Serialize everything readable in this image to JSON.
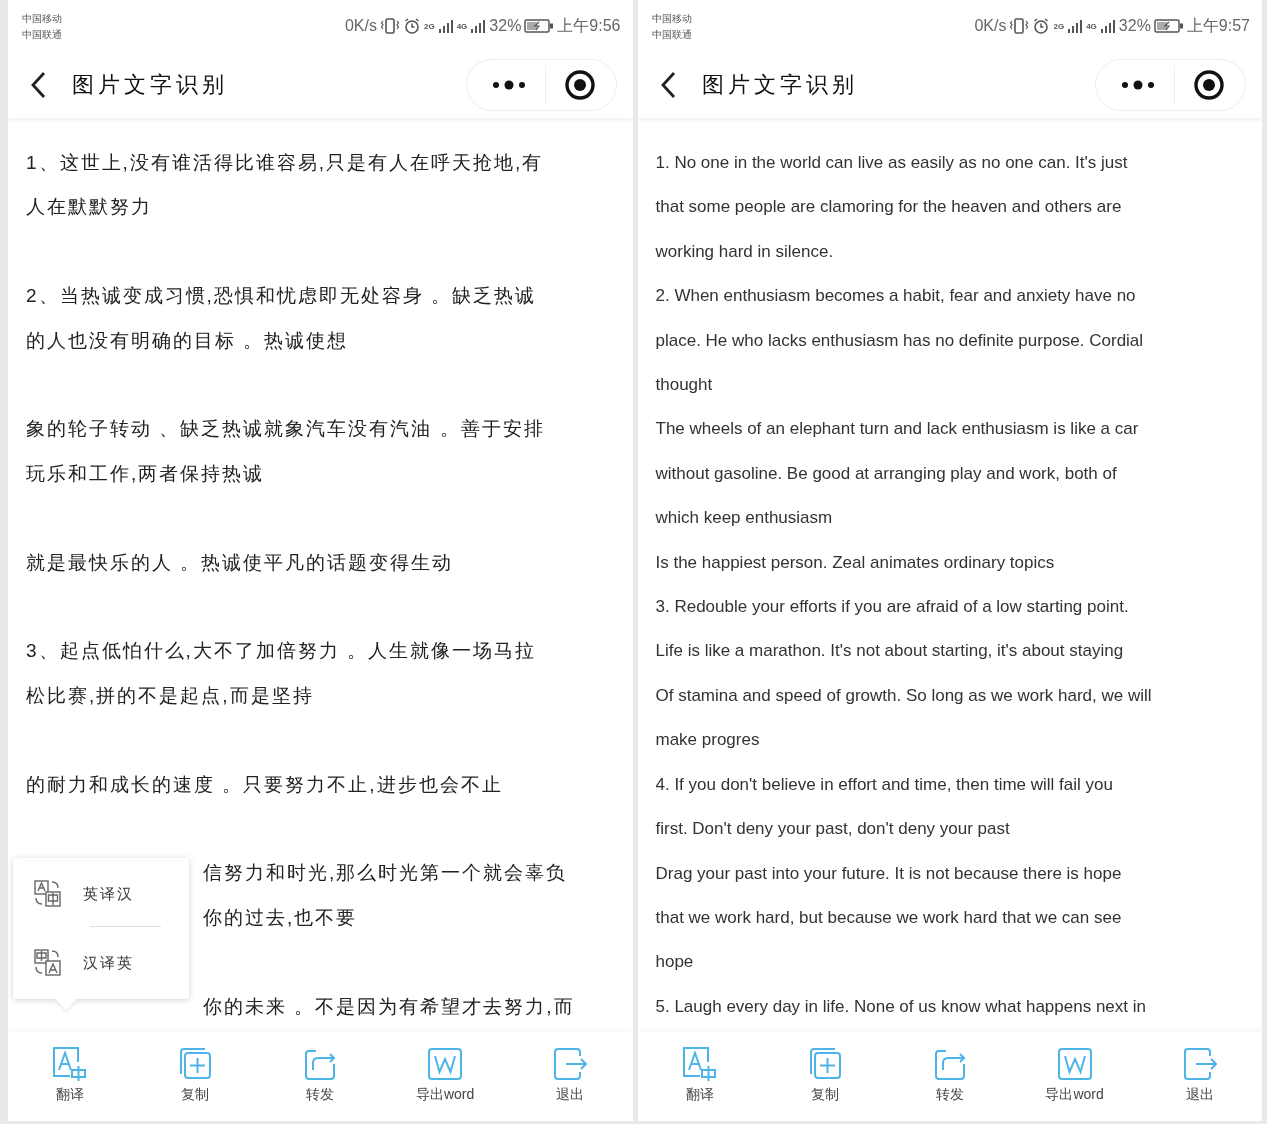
{
  "screens": [
    {
      "status_bar": {
        "carriers": [
          "中国移动",
          "中国联通"
        ],
        "speed": "0K/s",
        "networks": [
          "2G",
          "4G"
        ],
        "battery": "32%",
        "time": "上午9:56"
      },
      "title": "图片文字识别",
      "content": {
        "kind": "paragraphs",
        "paragraphs": [
          {
            "lines": [
              "1、这世上,没有谁活得比谁容易,只是有人在呼天抢地,有",
              "人在默默努力"
            ]
          },
          {
            "lines": [
              "2、当热诚变成习惯,恐惧和忧虑即无处容身 。缺乏热诚",
              "的人也没有明确的目标 。热诚使想"
            ]
          },
          {
            "lines": [
              "象的轮子转动 、缺乏热诚就象汽车没有汽油 。善于安排",
              "玩乐和工作,两者保持热诚"
            ]
          },
          {
            "lines": [
              "就是最快乐的人 。热诚使平凡的话题变得生动"
            ]
          },
          {
            "lines": [
              "3、起点低怕什么,大不了加倍努力 。人生就像一场马拉",
              "松比赛,拼的不是起点,而是坚持"
            ]
          },
          {
            "lines": [
              "的耐力和成长的速度 。只要努力不止,进步也会不止"
            ]
          }
        ],
        "paragraphs_beside_popup": [
          {
            "lines": [
              "信努力和时光,那么时光第一个就会辜负",
              "你的过去,也不要"
            ]
          },
          {
            "lines": [
              "你的未来 。不是因为有希望才去努力,而"
            ]
          }
        ]
      },
      "popup": {
        "items": [
          {
            "kind": "en-zh",
            "label": "英译汉"
          },
          {
            "kind": "zh-en",
            "label": "汉译英"
          }
        ]
      },
      "toolbar": [
        {
          "kind": "translate",
          "label": "翻译"
        },
        {
          "kind": "copy",
          "label": "复制"
        },
        {
          "kind": "forward",
          "label": "转发"
        },
        {
          "kind": "export",
          "label": "导出word"
        },
        {
          "kind": "exit",
          "label": "退出"
        }
      ]
    },
    {
      "status_bar": {
        "carriers": [
          "中国移动",
          "中国联通"
        ],
        "speed": "0K/s",
        "networks": [
          "2G",
          "4G"
        ],
        "battery": "32%",
        "time": "上午9:57"
      },
      "title": "图片文字识别",
      "content": {
        "kind": "lines",
        "lines": [
          "1. No one in the world can live as easily as no one can. It's just",
          "that some people are clamoring for the heaven and others are",
          "working hard in silence.",
          "2. When enthusiasm becomes a habit, fear and anxiety have no",
          "place. He who lacks enthusiasm has no definite purpose. Cordial",
          "thought",
          "The wheels of an elephant turn and lack enthusiasm is like a car",
          "without gasoline. Be good at arranging play and work, both of",
          "which keep enthusiasm",
          "Is the happiest person. Zeal animates ordinary topics",
          "3. Redouble your efforts if you are afraid of a low starting point.",
          "Life is like a marathon. It's not about starting, it's about staying",
          "Of stamina and speed of growth. So long as we work hard, we will",
          "make progres",
          "4. If you don't believe in effort and time, then time will fail you",
          "first. Don't deny your past, don't deny your past",
          "Drag your past into your future. It is not because there is hope",
          "that we work hard, but because we work hard that we can see",
          "hope",
          "5. Laugh every day in life. None of us know what happens next in"
        ]
      },
      "toolbar": [
        {
          "kind": "translate",
          "label": "翻译"
        },
        {
          "kind": "copy",
          "label": "复制"
        },
        {
          "kind": "forward",
          "label": "转发"
        },
        {
          "kind": "export",
          "label": "导出word"
        },
        {
          "kind": "exit",
          "label": "退出"
        }
      ]
    }
  ]
}
